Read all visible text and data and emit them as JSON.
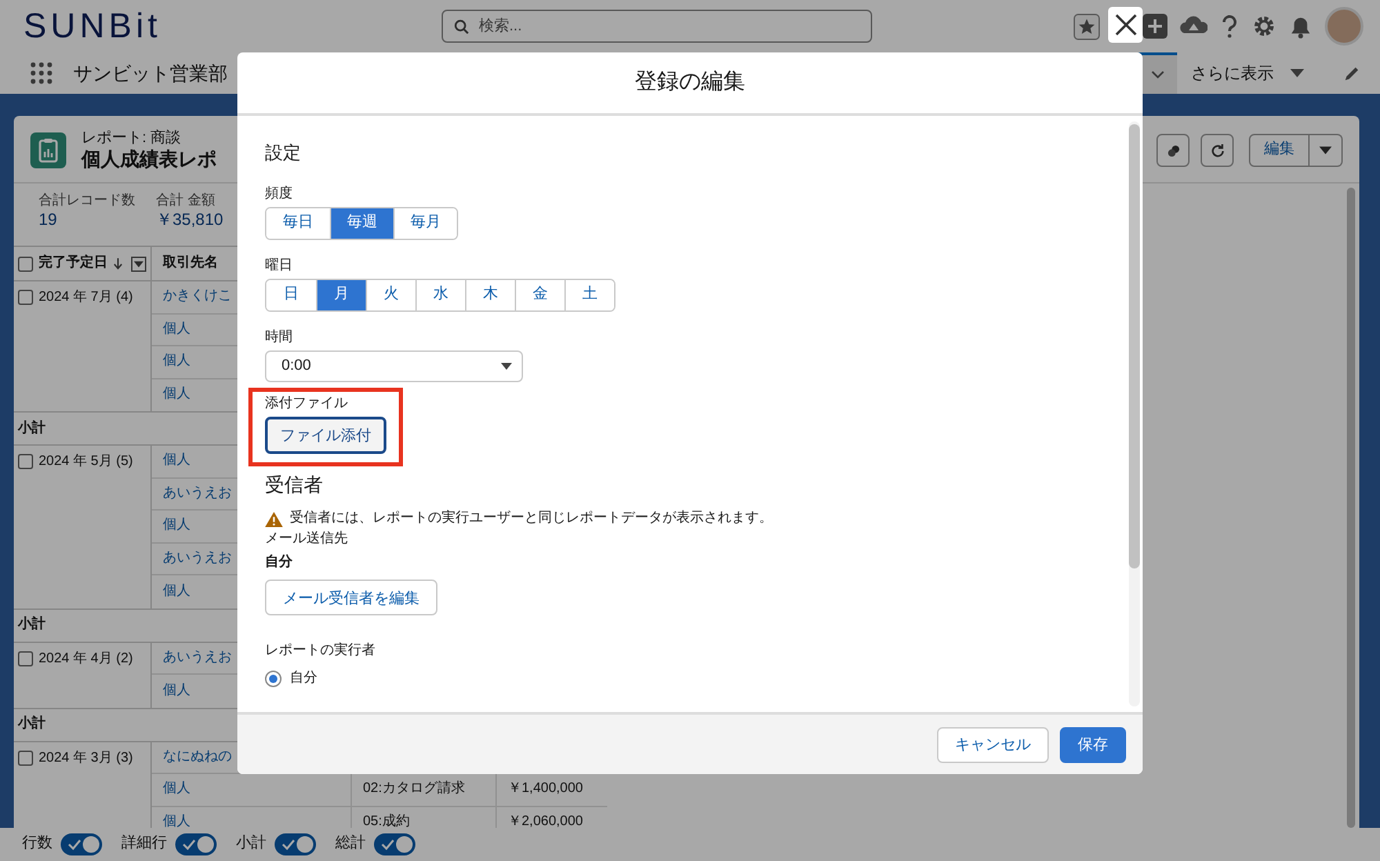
{
  "header": {
    "logo": "SUNBit",
    "search": {
      "placeholder": "検索..."
    }
  },
  "nav": {
    "app_name": "サンビット営業部",
    "more": "さらに表示"
  },
  "report": {
    "type_label": "レポート: 商談",
    "title": "個人成績表レポ",
    "edit_button": "編集",
    "summary": [
      {
        "label": "合計レコード数",
        "value": "19"
      },
      {
        "label": "合計 金額",
        "value": "￥35,810"
      }
    ],
    "table": {
      "columns": [
        "完了予定日",
        "取引先名"
      ],
      "select_all_checked": false,
      "groups": [
        {
          "label": "2024 年 7月 (4)",
          "checked": false,
          "rows": [
            {
              "cells": [
                "かきくけこ"
              ]
            },
            {
              "cells": [
                "個人"
              ]
            },
            {
              "cells": [
                "個人"
              ]
            },
            {
              "cells": [
                "個人"
              ]
            }
          ],
          "subtotal": "小計"
        },
        {
          "label": "2024 年 5月 (5)",
          "checked": false,
          "rows": [
            {
              "cells": [
                "個人"
              ]
            },
            {
              "cells": [
                "あいうえお"
              ]
            },
            {
              "cells": [
                "個人"
              ]
            },
            {
              "cells": [
                "あいうえお"
              ]
            },
            {
              "cells": [
                "個人"
              ]
            }
          ],
          "subtotal": "小計"
        },
        {
          "label": "2024 年 4月 (2)",
          "checked": false,
          "rows": [
            {
              "cells": [
                "あいうえお"
              ]
            },
            {
              "cells": [
                "個人"
              ]
            }
          ],
          "subtotal": "小計"
        },
        {
          "label": "2024 年 3月 (3)",
          "checked": false,
          "rows": [
            {
              "cells": [
                "なにぬねの"
              ]
            },
            {
              "cells": [
                "個人",
                "02:カタログ請求",
                "￥1,400,000"
              ]
            },
            {
              "cells": [
                "個人",
                "05:成約",
                "￥2,060,000"
              ]
            }
          ]
        }
      ]
    }
  },
  "footer_toggles": [
    {
      "label": "行数",
      "on": true
    },
    {
      "label": "詳細行",
      "on": true
    },
    {
      "label": "小計",
      "on": true
    },
    {
      "label": "総計",
      "on": true
    }
  ],
  "modal": {
    "title": "登録の編集",
    "settings_heading": "設定",
    "frequency": {
      "label": "頻度",
      "options": [
        {
          "label": "毎日",
          "selected": false
        },
        {
          "label": "毎週",
          "selected": true
        },
        {
          "label": "毎月",
          "selected": false
        }
      ]
    },
    "weekday": {
      "label": "曜日",
      "options": [
        {
          "label": "日",
          "selected": false
        },
        {
          "label": "月",
          "selected": true
        },
        {
          "label": "火",
          "selected": false
        },
        {
          "label": "水",
          "selected": false
        },
        {
          "label": "木",
          "selected": false
        },
        {
          "label": "金",
          "selected": false
        },
        {
          "label": "土",
          "selected": false
        }
      ]
    },
    "time": {
      "label": "時間",
      "value": "0:00"
    },
    "attachment": {
      "label": "添付ファイル",
      "button": "ファイル添付",
      "highlighted": true
    },
    "recipients_heading": "受信者",
    "warning": "受信者には、レポートの実行ユーザーと同じレポートデータが表示されます。",
    "mail_to": {
      "label": "メール送信先",
      "value": "自分"
    },
    "edit_recipients_button": "メール受信者を編集",
    "run_as": {
      "label": "レポートの実行者",
      "options": [
        {
          "label": "自分",
          "selected": true
        }
      ]
    },
    "buttons": {
      "cancel": "キャンセル",
      "save": "保存"
    }
  }
}
